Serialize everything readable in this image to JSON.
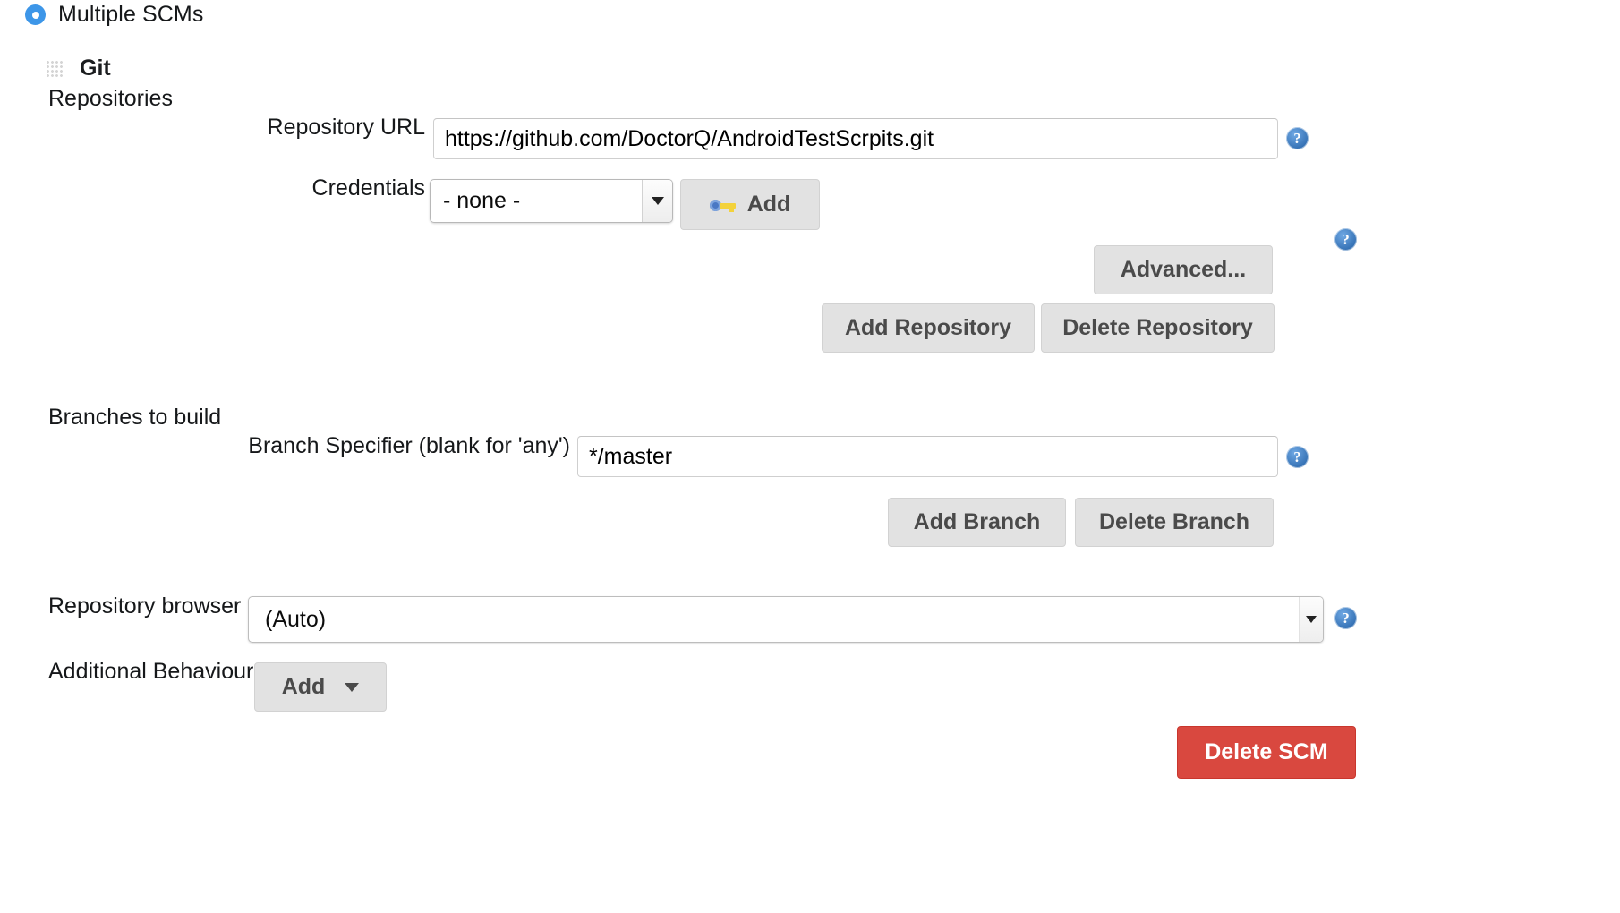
{
  "scm": {
    "radio_label": "Multiple SCMs",
    "radio_selected": true,
    "section_title": "Git",
    "grip_icon": "drag-handle-icon"
  },
  "repositories": {
    "section_label": "Repositories",
    "repository_url": {
      "label": "Repository URL",
      "value": "https://github.com/DoctorQ/AndroidTestScrpits.git"
    },
    "credentials": {
      "label": "Credentials",
      "selected": "- none -",
      "options": [
        "- none -"
      ],
      "add_button": "Add",
      "add_icon": "key-icon"
    },
    "advanced_button": "Advanced...",
    "add_repository_button": "Add Repository",
    "delete_repository_button": "Delete Repository"
  },
  "branches": {
    "section_label": "Branches to build",
    "branch_specifier": {
      "label": "Branch Specifier (blank for 'any')",
      "value": "*/master"
    },
    "add_branch_button": "Add Branch",
    "delete_branch_button": "Delete Branch"
  },
  "repository_browser": {
    "label": "Repository browser",
    "selected": "(Auto)",
    "options": [
      "(Auto)"
    ]
  },
  "additional_behaviours": {
    "label": "Additional Behaviours",
    "add_button": "Add",
    "caret_icon": "chevron-down-icon"
  },
  "footer": {
    "delete_scm_button": "Delete SCM"
  },
  "help": {
    "glyph": "?",
    "icon_name": "help-icon"
  },
  "colors": {
    "accent_blue": "#3d96e8",
    "help_blue": "#2f6cb0",
    "danger_red": "#d9483f",
    "button_gray": "#e2e2e2",
    "button_text": "#4a4a4a"
  }
}
